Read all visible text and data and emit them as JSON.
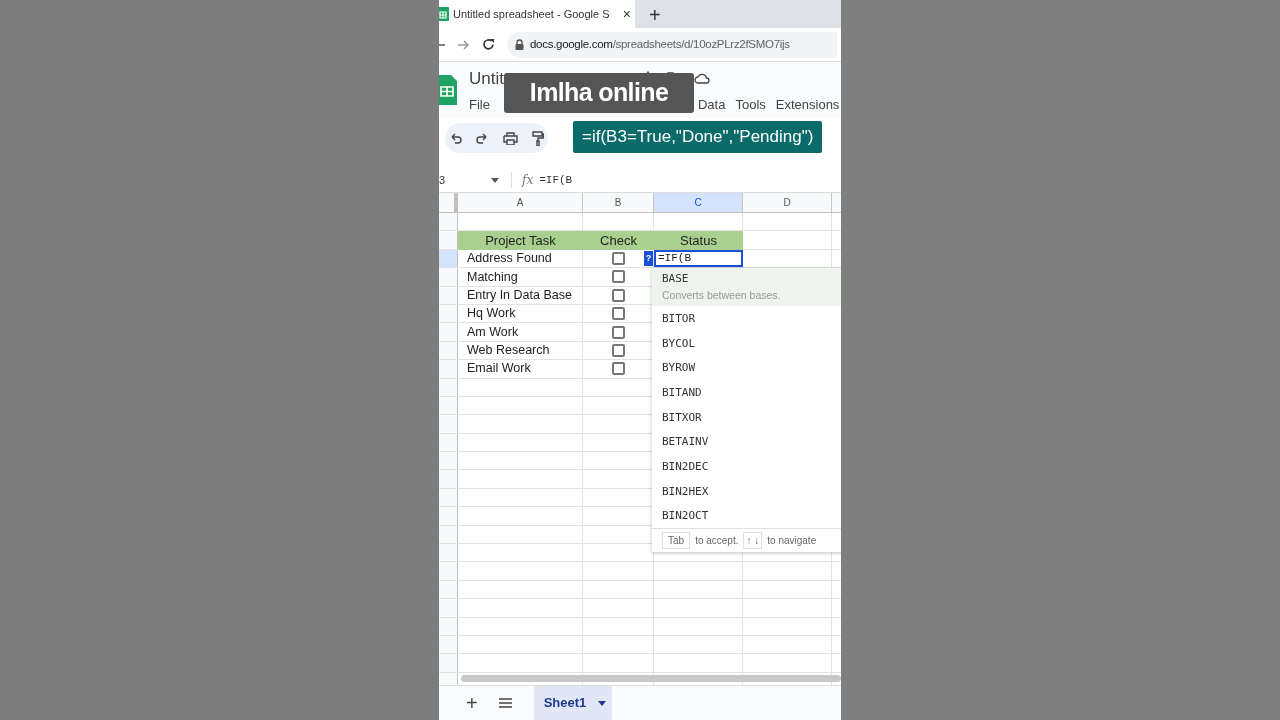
{
  "browser": {
    "tab_title": "Untitled spreadsheet - Google S",
    "close": "×",
    "new_tab": "+",
    "url_host": "docs.google.com",
    "url_path": "/spreadsheets/d/10ozPLrz2fSMO7ijs"
  },
  "app": {
    "title": "Untit",
    "menu": [
      "File",
      "Data",
      "Tools",
      "Extensions"
    ]
  },
  "fx_label": "fx",
  "add_sheet": "+",
  "caption": "Imlha online",
  "formula_banner": "=if(B3=True,\"Done\",\"Pending\")",
  "name_box": "3",
  "formula_bar": "=IF(B",
  "columns": [
    {
      "label": "A",
      "selected": false
    },
    {
      "label": "B",
      "selected": false
    },
    {
      "label": "C",
      "selected": true
    },
    {
      "label": "D",
      "selected": false
    }
  ],
  "header": [
    "Project Task",
    "Check",
    "Status"
  ],
  "tasks": [
    {
      "task": "Address Found",
      "checked": false,
      "selected": true
    },
    {
      "task": "Matching",
      "checked": false,
      "selected": false
    },
    {
      "task": "Entry In Data Base",
      "checked": false,
      "selected": false
    },
    {
      "task": "Hq Work",
      "checked": false,
      "selected": false
    },
    {
      "task": "Am Work",
      "checked": false,
      "selected": false
    },
    {
      "task": "Web Research",
      "checked": false,
      "selected": false
    },
    {
      "task": "Email Work",
      "checked": false,
      "selected": false
    }
  ],
  "editing_cell": {
    "help": "?",
    "value": "=IF(B"
  },
  "autocomplete": {
    "items": [
      {
        "name": "BASE",
        "description": "Converts between bases.",
        "selected": true
      },
      {
        "name": "BITOR",
        "selected": false
      },
      {
        "name": "BYCOL",
        "selected": false
      },
      {
        "name": "BYROW",
        "selected": false
      },
      {
        "name": "BITAND",
        "selected": false
      },
      {
        "name": "BITXOR",
        "selected": false
      },
      {
        "name": "BETAINV",
        "selected": false
      },
      {
        "name": "BIN2DEC",
        "selected": false
      },
      {
        "name": "BIN2HEX",
        "selected": false
      },
      {
        "name": "BIN2OCT",
        "selected": false
      }
    ],
    "footer": {
      "key": "Tab",
      "accept": "to accept.",
      "arrows": "↑ ↓",
      "navigate": "to navigate"
    }
  },
  "sheets": [
    {
      "label": "Sheet1",
      "selected": true
    }
  ]
}
